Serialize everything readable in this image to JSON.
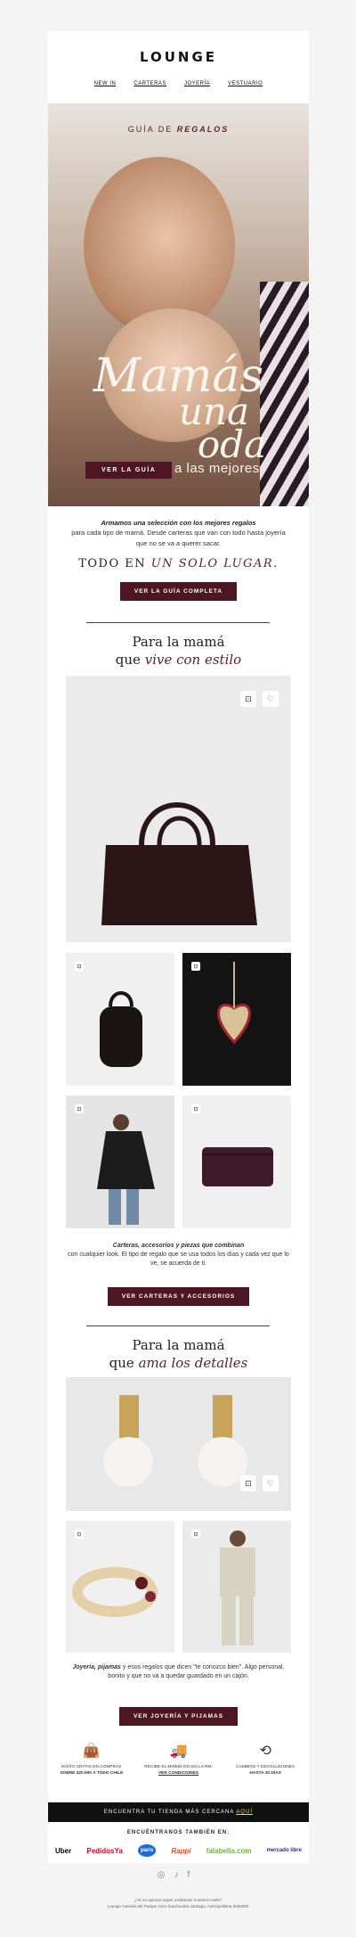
{
  "brand": {
    "logo": "LOUNGE"
  },
  "nav": [
    "NEW IN",
    "CARTERAS",
    "JOYERÍA",
    "VESTUARIO"
  ],
  "hero": {
    "kicker_a": "GUÍA DE ",
    "kicker_b": "REGALOS",
    "line1": "Mamás",
    "line2": "una",
    "line3": "oda",
    "line4": "a las mejores",
    "cta": "VER LA GUÍA"
  },
  "intro": {
    "p1a": "Armamos una selección con los mejores regalos",
    "p1b": "para cada tipo de mamá. Desde carteras que van con todo hasta joyería que no se va a querer sacar.",
    "tagline_a": "TODO EN ",
    "tagline_b": "UN SOLO LUGAR.",
    "cta": "VER LA GUÍA COMPLETA"
  },
  "section1": {
    "t1": "Para la mamá",
    "t2a": "que ",
    "t2b": "vive con estilo",
    "copy_a": "Carteras, accesorios y piezas que combinan",
    "copy_b": "con cualquier look. El tipo de regalo que se usa todos los días y cada vez que lo ve, se acuerda de ti.",
    "cta": "VER CARTERAS Y ACCESORIOS"
  },
  "section2": {
    "t1": "Para la mamá",
    "t2a": "que ",
    "t2b": "ama los detalles",
    "copy_a": "Joyería, pijamas",
    "copy_b": "y esos regalos que dicen \"te conozco bien\". Algo personal, bonito y que no va a quedar guardado en un cajón.",
    "cta": "VER JOYERÍA Y PIJAMAS"
  },
  "benefits": [
    {
      "icon": "shopping-bag-icon",
      "a": "ENVÍO GRATIS EN COMPRAS",
      "b": "SOBRE $20.990 A TODO CHILE"
    },
    {
      "icon": "truck-icon",
      "a": "RECIBE EL MISMO DÍA EN LA RM.",
      "b": "VER CONDICIONES"
    },
    {
      "icon": "return-icon",
      "a": "CAMBIOS Y DEVOLUCIONES",
      "b": "HASTA 30 DÍAS"
    }
  ],
  "store_bar": {
    "text": "ENCUENTRA TU TIENDA MÁS CERCANA ",
    "link": "AQUÍ"
  },
  "partners_title": "ENCUÉNTRANOS TAMBIÉN EN:",
  "partners": [
    "Uber",
    "PedidosYa",
    "paris",
    "Rappi",
    "falabella.com",
    "mercado libre"
  ],
  "footer": {
    "a": "¿Ya no quieres seguir recibiendo nuestros mails?",
    "b": "Lounge Avenida del Parque 4161 huechuraba santiago, metropolitana 8580000"
  },
  "colors": {
    "accent": "#4e1523",
    "bar": "#111111"
  }
}
